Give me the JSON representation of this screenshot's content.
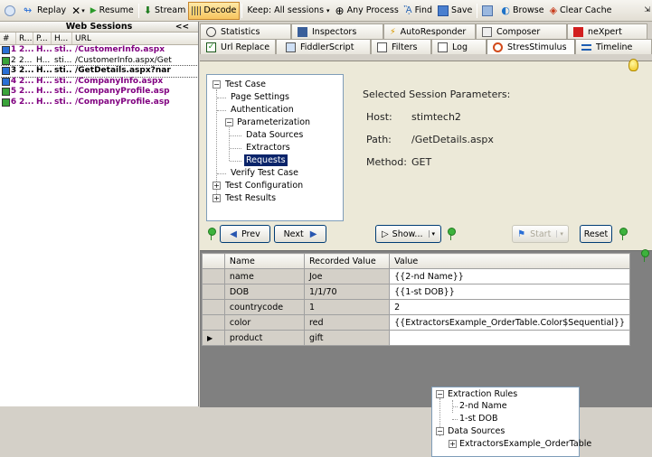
{
  "toolbar": {
    "replay": "Replay",
    "resume": "Resume",
    "stream": "Stream",
    "decode": "Decode",
    "keep": "Keep: All sessions",
    "any_process": "Any Process",
    "find": "Find",
    "save": "Save",
    "browse": "Browse",
    "clear_cache": "Clear Cache"
  },
  "sessions": {
    "title": "Web Sessions",
    "collapse": "<<",
    "columns": [
      "#",
      "R...",
      "P...",
      "H...",
      "URL"
    ],
    "rows": [
      {
        "num": "1",
        "result": "2...",
        "proto": "H...",
        "host": "sti...",
        "url": "/CustomerInfo.aspx",
        "color": "#800080",
        "bold": true
      },
      {
        "num": "2",
        "result": "2...",
        "proto": "H...",
        "host": "sti...",
        "url": "/CustomerInfo.aspx/Get",
        "color": "#000000",
        "bold": false
      },
      {
        "num": "3",
        "result": "2...",
        "proto": "H...",
        "host": "sti...",
        "url": "/GetDetails.aspx?nar",
        "color": "#000000",
        "bold": true
      },
      {
        "num": "4",
        "result": "2...",
        "proto": "H...",
        "host": "sti...",
        "url": "/CompanyInfo.aspx",
        "color": "#800080",
        "bold": true
      },
      {
        "num": "5",
        "result": "2...",
        "proto": "H...",
        "host": "sti...",
        "url": "/CompanyProfile.asp",
        "color": "#800080",
        "bold": true
      },
      {
        "num": "6",
        "result": "2...",
        "proto": "H...",
        "host": "sti...",
        "url": "/CompanyProfile.asp",
        "color": "#800080",
        "bold": true
      }
    ]
  },
  "tabs_top": [
    "Statistics",
    "Inspectors",
    "AutoResponder",
    "Composer",
    "neXpert"
  ],
  "tabs_bottom": [
    "Url Replace",
    "FiddlerScript",
    "Filters",
    "Log",
    "StresStimulus",
    "Timeline"
  ],
  "tree": {
    "test_case": "Test Case",
    "page_settings": "Page Settings",
    "authentication": "Authentication",
    "parameterization": "Parameterization",
    "data_sources": "Data Sources",
    "extractors": "Extractors",
    "requests": "Requests",
    "verify": "Verify Test Case",
    "test_config": "Test Configuration",
    "test_results": "Test Results"
  },
  "params": {
    "heading": "Selected Session Parameters:",
    "host_label": "Host:",
    "host_value": "stimtech2",
    "path_label": "Path:",
    "path_value": "/GetDetails.aspx",
    "method_label": "Method:",
    "method_value": "GET"
  },
  "buttons": {
    "prev": "Prev",
    "next": "Next",
    "show": "Show...",
    "start": "Start",
    "reset": "Reset"
  },
  "grid": {
    "columns": [
      "Name",
      "Recorded Value",
      "Value"
    ],
    "rows": [
      {
        "name": "name",
        "recorded": "Joe",
        "value": "{{2-nd Name}}"
      },
      {
        "name": "DOB",
        "recorded": "1/1/70",
        "value": "{{1-st DOB}}"
      },
      {
        "name": "countrycode",
        "recorded": "1",
        "value": "2"
      },
      {
        "name": "color",
        "recorded": "red",
        "value": "{{ExtractorsExample_OrderTable.Color$Sequential}}"
      },
      {
        "name": "product",
        "recorded": "gift",
        "value": ""
      }
    ]
  },
  "dropdown_tree": {
    "extraction_rules": "Extraction Rules",
    "second_name": "2-nd Name",
    "first_dob": "1-st DOB",
    "data_sources": "Data Sources",
    "order_table": "ExtractorsExample_OrderTable"
  }
}
